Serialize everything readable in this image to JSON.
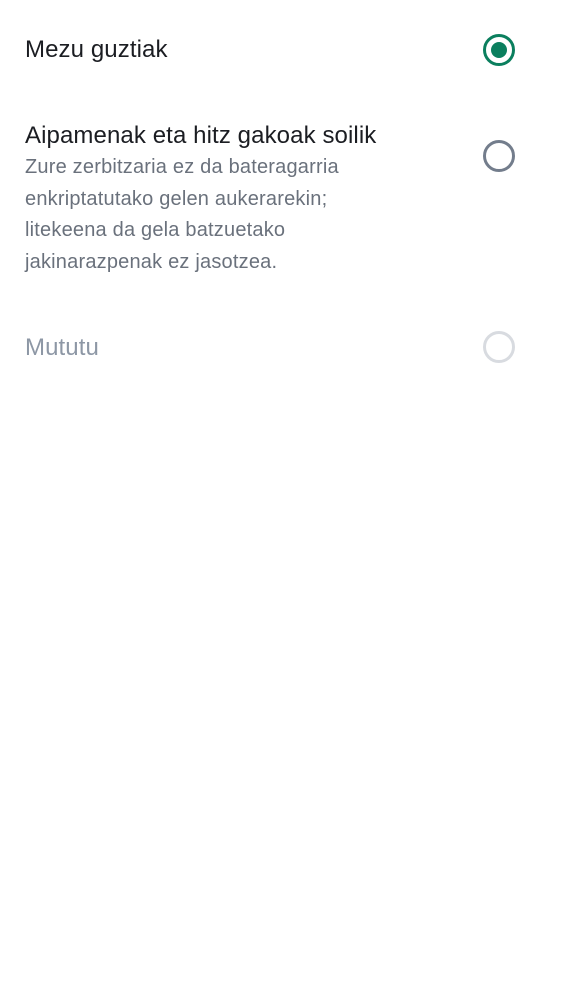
{
  "notification_options": [
    {
      "title": "Mezu guztiak",
      "description": "",
      "selected": true,
      "disabled": false
    },
    {
      "title": "Aipamenak eta hitz gakoak soilik",
      "description": "Zure zerbitzaria ez da bateragarria enkriptatutako gelen aukerarekin; litekeena da gela batzuetako jakinarazpenak ez jasotzea.",
      "selected": false,
      "disabled": false
    },
    {
      "title": "Mututu",
      "description": "",
      "selected": false,
      "disabled": true
    }
  ],
  "colors": {
    "accent": "#0b7f5e",
    "radio_unchecked": "#737d8c",
    "radio_disabled": "#d8dbe0",
    "text_primary": "#1b1d22",
    "text_secondary": "#6a717c",
    "text_disabled": "#8d97a5"
  }
}
